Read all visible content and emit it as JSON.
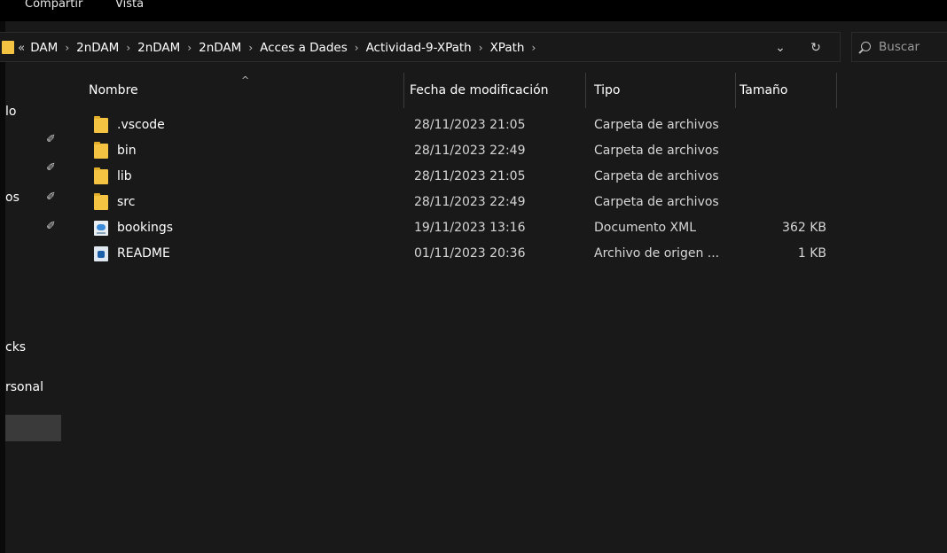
{
  "ribbon": {
    "tabs": [
      "Compartir",
      "Vista"
    ]
  },
  "address": {
    "overflow": "«",
    "crumbs": [
      "DAM",
      "2nDAM",
      "2nDAM",
      "2nDAM",
      "Acces a Dades",
      "Actividad-9-XPath",
      "XPath"
    ],
    "separator": "›",
    "dropdown_icon": "chevron-down-icon",
    "refresh_icon": "refresh-icon"
  },
  "search": {
    "placeholder": "Buscar"
  },
  "nav": {
    "items": [
      {
        "label": "lo",
        "pinned": false
      },
      {
        "label": "",
        "pinned": true
      },
      {
        "label": "",
        "pinned": true
      },
      {
        "label": "os",
        "pinned": true
      },
      {
        "label": "",
        "pinned": true
      },
      {
        "label": "cks",
        "pinned": false
      },
      {
        "label": "rsonal",
        "pinned": false
      }
    ]
  },
  "columns": {
    "name": "Nombre",
    "modified": "Fecha de modificación",
    "type": "Tipo",
    "size": "Tamaño"
  },
  "files": [
    {
      "icon": "folder-icon",
      "name": ".vscode",
      "modified": "28/11/2023 21:05",
      "type": "Carpeta de archivos",
      "size": ""
    },
    {
      "icon": "folder-icon",
      "name": "bin",
      "modified": "28/11/2023 22:49",
      "type": "Carpeta de archivos",
      "size": ""
    },
    {
      "icon": "folder-icon",
      "name": "lib",
      "modified": "28/11/2023 21:05",
      "type": "Carpeta de archivos",
      "size": ""
    },
    {
      "icon": "folder-icon",
      "name": "src",
      "modified": "28/11/2023 22:49",
      "type": "Carpeta de archivos",
      "size": ""
    },
    {
      "icon": "xml-file-icon",
      "name": "bookings",
      "modified": "19/11/2023 13:16",
      "type": "Documento XML",
      "size": "362 KB"
    },
    {
      "icon": "source-file-icon",
      "name": "README",
      "modified": "01/11/2023 20:36",
      "type": "Archivo de origen ...",
      "size": "1 KB"
    }
  ],
  "colors": {
    "background": "#191919",
    "folder": "#f5c342",
    "selection": "#3a3a3a"
  }
}
